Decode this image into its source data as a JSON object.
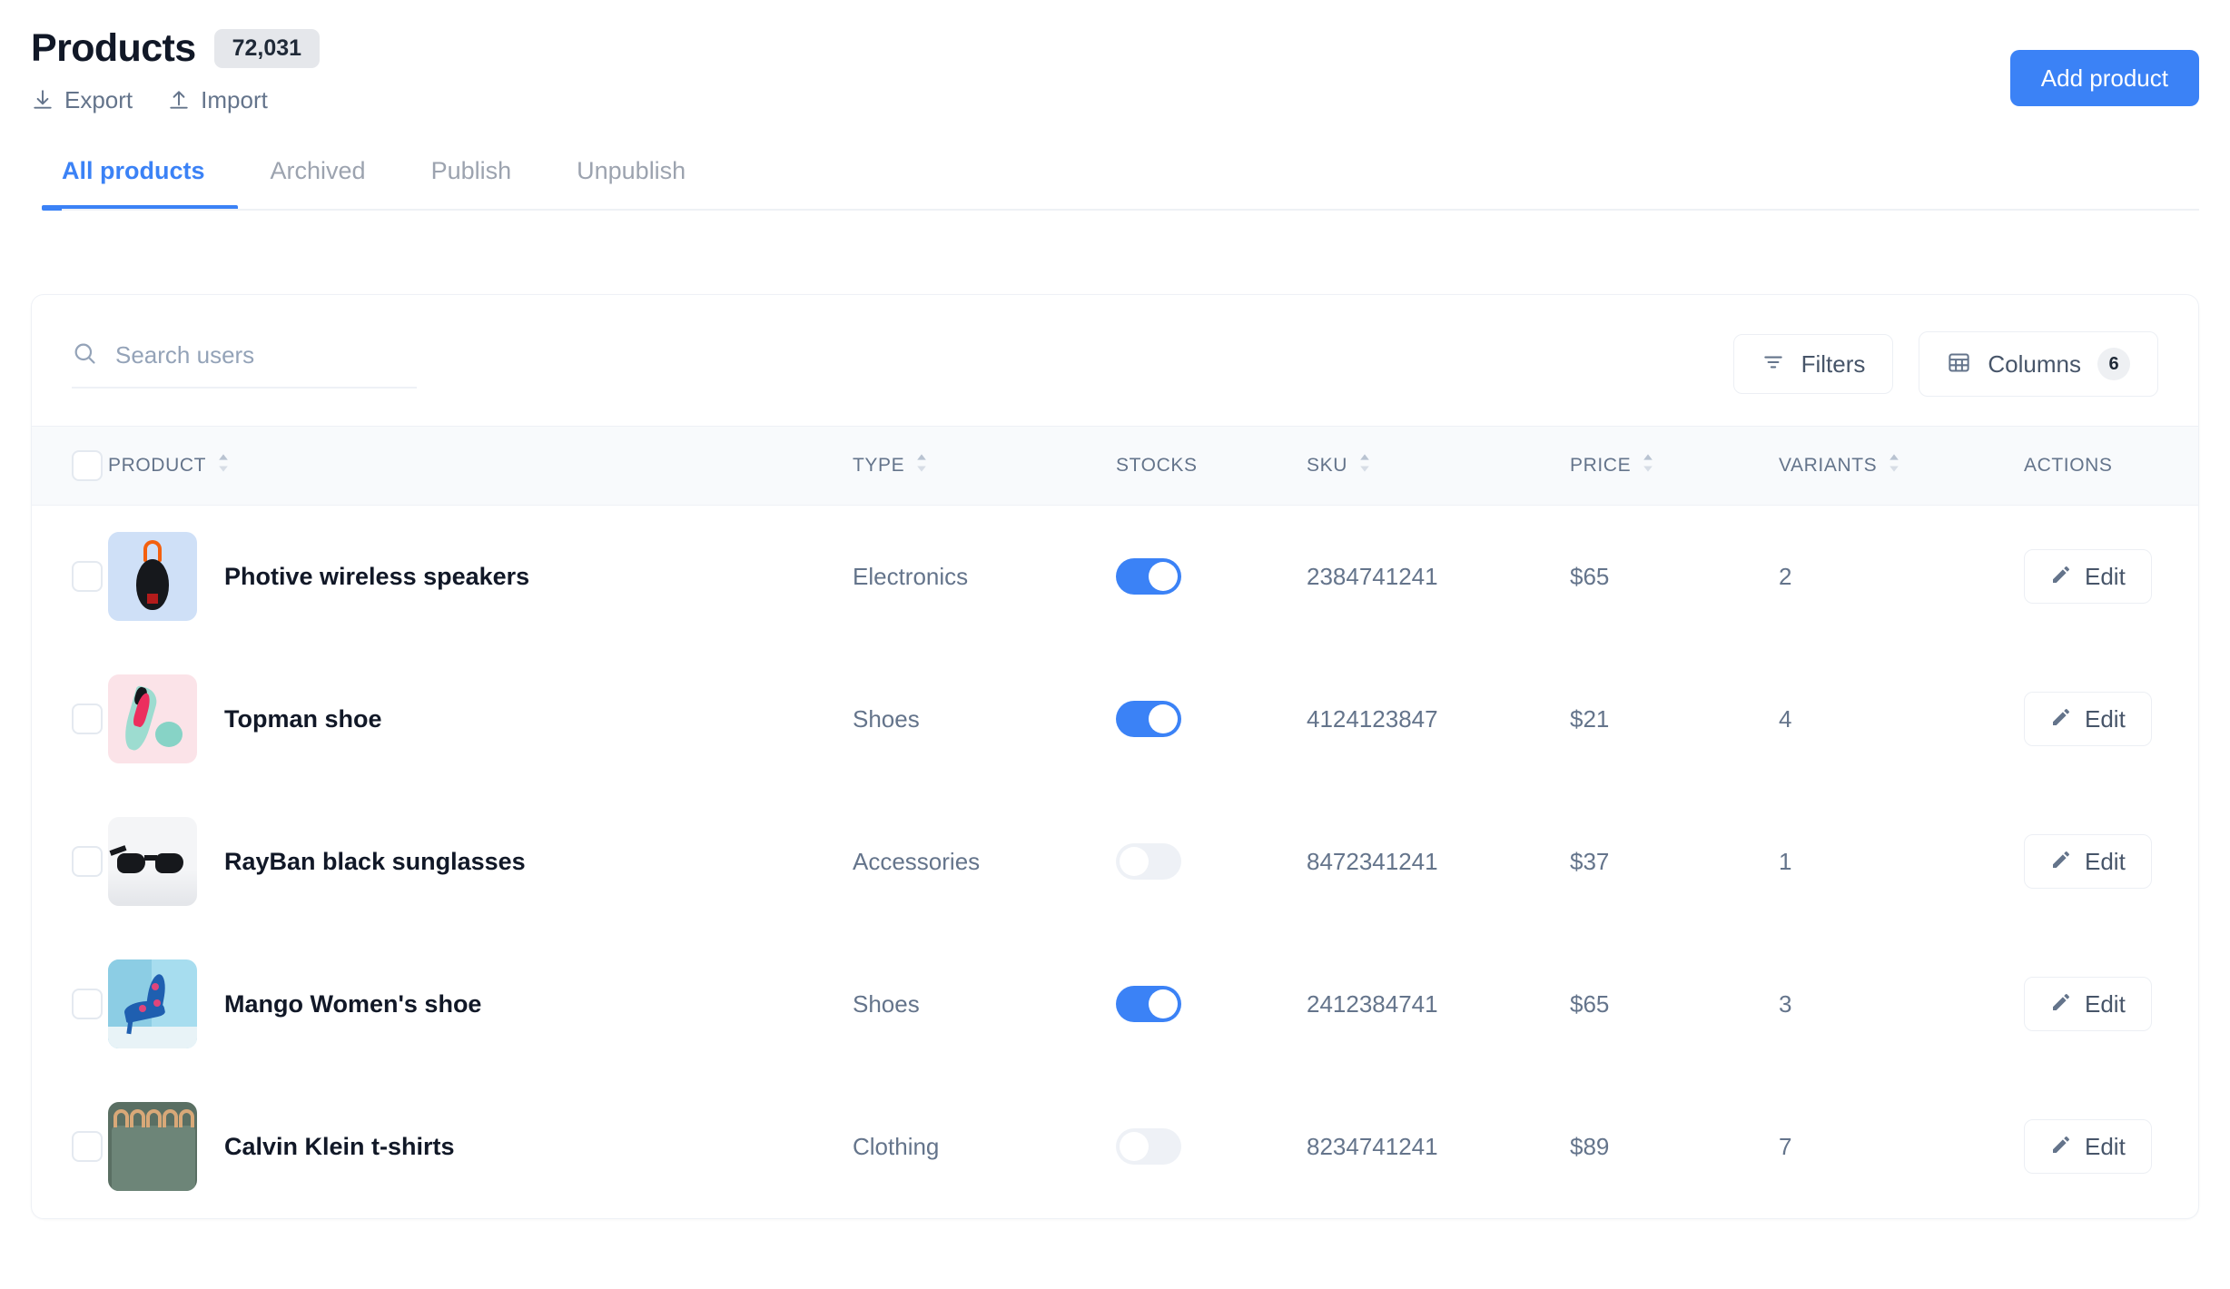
{
  "header": {
    "title": "Products",
    "count": "72,031",
    "export_label": "Export",
    "import_label": "Import",
    "add_product_label": "Add product",
    "accent_color": "#3b82f6"
  },
  "tabs": [
    {
      "label": "All products",
      "active": true
    },
    {
      "label": "Archived",
      "active": false
    },
    {
      "label": "Publish",
      "active": false
    },
    {
      "label": "Unpublish",
      "active": false
    }
  ],
  "toolbar": {
    "search_placeholder": "Search users",
    "search_value": "",
    "filters_label": "Filters",
    "columns_label": "Columns",
    "columns_count": "6"
  },
  "table": {
    "columns": [
      {
        "label": "PRODUCT",
        "sortable": true
      },
      {
        "label": "TYPE",
        "sortable": true
      },
      {
        "label": "STOCKS",
        "sortable": false
      },
      {
        "label": "SKU",
        "sortable": true
      },
      {
        "label": "PRICE",
        "sortable": true
      },
      {
        "label": "VARIANTS",
        "sortable": true
      },
      {
        "label": "ACTIONS",
        "sortable": false
      }
    ],
    "edit_label": "Edit",
    "rows": [
      {
        "product": "Photive wireless speakers",
        "type": "Electronics",
        "stock_on": true,
        "sku": "2384741241",
        "price": "$65",
        "variants": "2",
        "thumb": "speaker"
      },
      {
        "product": "Topman shoe",
        "type": "Shoes",
        "stock_on": true,
        "sku": "4124123847",
        "price": "$21",
        "variants": "4",
        "thumb": "heel"
      },
      {
        "product": "RayBan black sunglasses",
        "type": "Accessories",
        "stock_on": false,
        "sku": "8472341241",
        "price": "$37",
        "variants": "1",
        "thumb": "sunglasses"
      },
      {
        "product": "Mango Women's shoe",
        "type": "Shoes",
        "stock_on": true,
        "sku": "2412384741",
        "price": "$65",
        "variants": "3",
        "thumb": "floral-heel"
      },
      {
        "product": "Calvin Klein t-shirts",
        "type": "Clothing",
        "stock_on": false,
        "sku": "8234741241",
        "price": "$89",
        "variants": "7",
        "thumb": "shirts"
      }
    ]
  }
}
